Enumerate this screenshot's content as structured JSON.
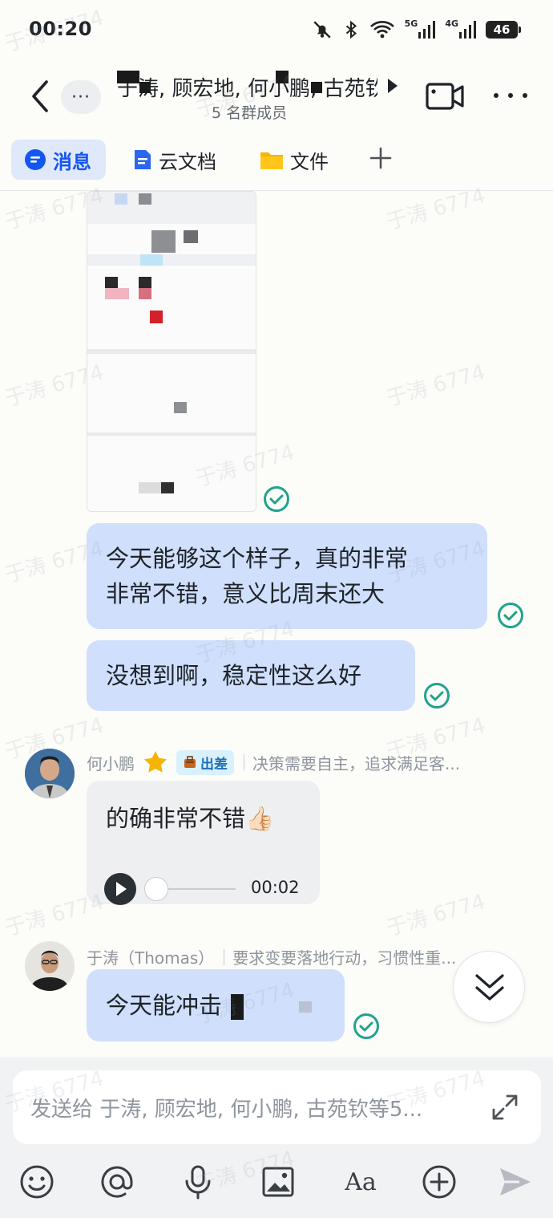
{
  "status_bar": {
    "time": "00:20",
    "battery": "46",
    "net1": "5G",
    "net2": "4G"
  },
  "header": {
    "title": "于涛, 顾宏地, 何小鹏, 古苑钦, ...",
    "member_count": "5 名群成员",
    "more_label": "···"
  },
  "tabs": [
    {
      "label": "消息",
      "icon": "chat-bubble-icon",
      "active": true
    },
    {
      "label": "云文档",
      "icon": "document-icon",
      "active": false
    },
    {
      "label": "文件",
      "icon": "folder-icon",
      "active": false
    }
  ],
  "messages": [
    {
      "type": "image",
      "from": "self",
      "status": "read"
    },
    {
      "type": "text",
      "from": "self",
      "lines": [
        "今天能够这个样子，真的非常",
        "非常不错，意义比周末还大"
      ],
      "status": "read"
    },
    {
      "type": "text",
      "from": "self",
      "lines": [
        "没想到啊，稳定性这么好"
      ],
      "status": "read"
    },
    {
      "type": "voice",
      "sender": {
        "name": "何小鹏",
        "badge": "出差",
        "signature": "决策需要自主，追求满足客..."
      },
      "text": "的确非常不错👍🏻",
      "duration": "00:02"
    },
    {
      "type": "text",
      "sender": {
        "name": "于涛（Thomas）",
        "signature": "要求变要落地行动，习惯性重..."
      },
      "text": "今天能冲击",
      "status": "read"
    }
  ],
  "composer": {
    "placeholder": "发送给 于涛, 顾宏地, 何小鹏, 古苑钦等5...",
    "tools": [
      "emoji-icon",
      "mention-icon",
      "microphone-icon",
      "image-icon",
      "text-format-icon",
      "add-circle-icon",
      "send-icon"
    ],
    "format_label": "Aa"
  },
  "watermark": "于涛 6774",
  "colors": {
    "accent": "#1456f0",
    "self_bubble": "#cfdffc",
    "other_bubble": "#eeeff1",
    "read_check": "#21a28c"
  }
}
